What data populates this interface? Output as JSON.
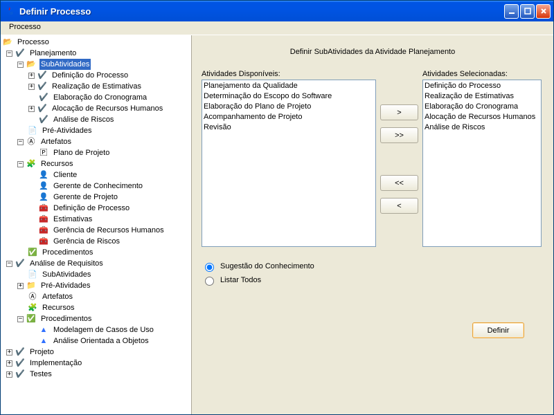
{
  "window": {
    "title": "Definir Processo"
  },
  "menubar": {
    "item1": "Processo"
  },
  "tree": {
    "root": "Processo",
    "planejamento": "Planejamento",
    "subatividades": "SubAtividades",
    "def_processo": "Definição do Processo",
    "real_estim": "Realização de Estimativas",
    "elab_cron": "Elaboração do Cronograma",
    "aloc_rh": "Alocação de Recursos Humanos",
    "anal_risc": "Análise de Riscos",
    "pre_ativ": "Pré-Atividades",
    "artefatos": "Artefatos",
    "plano_proj": "Plano de Projeto",
    "recursos": "Recursos",
    "cliente": "Cliente",
    "ger_conh": "Gerente de Conhecimento",
    "ger_proj": "Gerente de Projeto",
    "def_proc2": "Definição de Processo",
    "estimativas": "Estimativas",
    "ger_rh": "Gerência de Recursos Humanos",
    "ger_riscos": "Gerência de Riscos",
    "procedimentos": "Procedimentos",
    "anal_req": "Análise de Requisitos",
    "subativ2": "SubAtividades",
    "preativ2": "Pré-Atividades",
    "artefatos2": "Artefatos",
    "recursos2": "Recursos",
    "procedimentos2": "Procedimentos",
    "model_casos": "Modelagem de Casos de Uso",
    "anal_obj": "Análise Orientada a Objetos",
    "projeto": "Projeto",
    "implementacao": "Implementação",
    "testes": "Testes"
  },
  "panel": {
    "heading": "Definir SubAtividades da Atividade Planejamento",
    "available_label": "Atividades Disponíveis:",
    "selected_label": "Atividades Selecionadas:",
    "available": {
      "a0": "Planejamento da Qualidade",
      "a1": "Determinação do Escopo do Software",
      "a2": "Elaboração do Plano de Projeto",
      "a3": "Acompanhamento de Projeto",
      "a4": "Revisão"
    },
    "selected": {
      "s0": "Definição do Processo",
      "s1": "Realização de Estimativas",
      "s2": "Elaboração do Cronograma",
      "s3": "Alocação de Recursos Humanos",
      "s4": "Análise de Riscos"
    },
    "btn_right": ">",
    "btn_right_all": ">>",
    "btn_left_all": "<<",
    "btn_left": "<",
    "radio1": "Sugestão do Conhecimento",
    "radio2": "Listar Todos",
    "definir": "Definir"
  }
}
